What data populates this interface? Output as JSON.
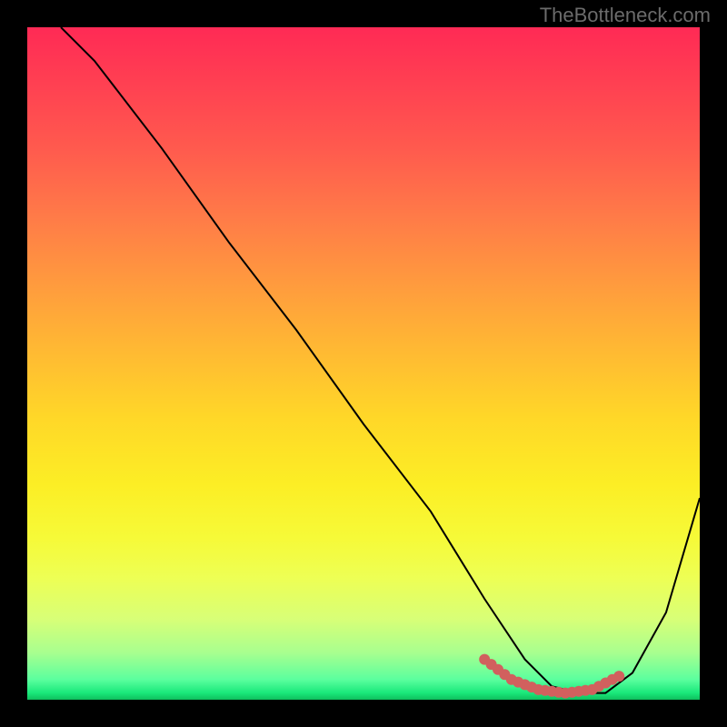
{
  "watermark": "TheBottleneck.com",
  "chart_data": {
    "type": "line",
    "title": "",
    "xlabel": "",
    "ylabel": "",
    "xlim": [
      0,
      100
    ],
    "ylim": [
      0,
      100
    ],
    "series": [
      {
        "name": "main-curve",
        "color": "#000000",
        "x": [
          5,
          10,
          20,
          30,
          40,
          50,
          60,
          68,
          74,
          78,
          82,
          86,
          90,
          95,
          100
        ],
        "y": [
          100,
          95,
          82,
          68,
          55,
          41,
          28,
          15,
          6,
          2,
          1,
          1,
          4,
          13,
          30
        ]
      },
      {
        "name": "highlight-segment",
        "color": "#d1605e",
        "style": "thick-dotted",
        "x": [
          68,
          72,
          76,
          80,
          84,
          88
        ],
        "y": [
          6,
          3,
          1.5,
          1,
          1.5,
          3.5
        ]
      }
    ],
    "gradient_background": {
      "top_color": "#ff2a55",
      "mid_top_color": "#ff9a3e",
      "mid_color": "#ffd728",
      "mid_bottom_color": "#edff55",
      "bottom_color": "#19e87a"
    }
  }
}
